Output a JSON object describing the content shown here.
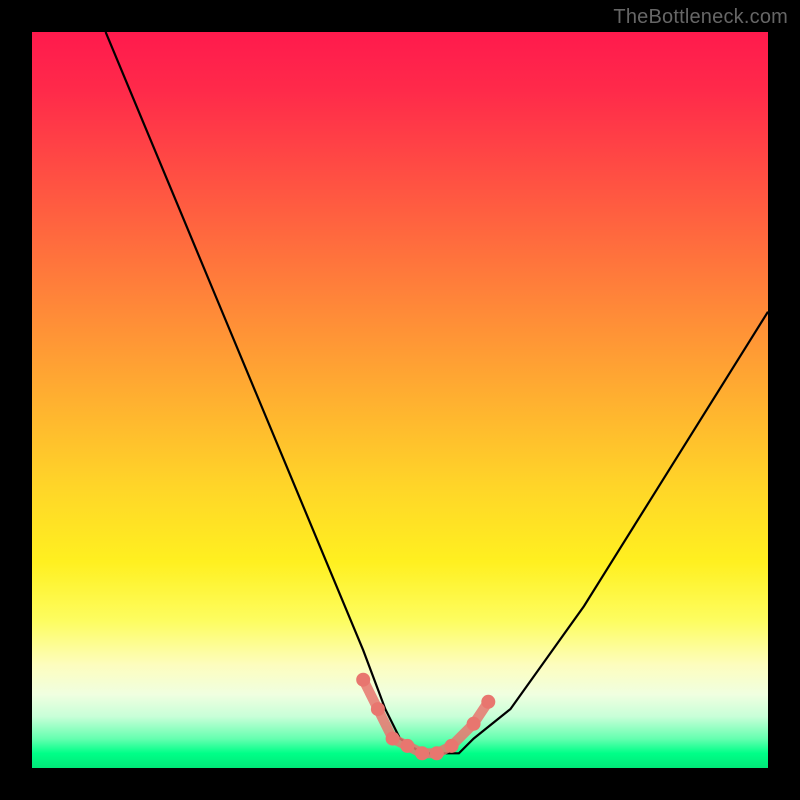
{
  "watermark": "TheBottleneck.com",
  "chart_data": {
    "type": "line",
    "title": "",
    "xlabel": "",
    "ylabel": "",
    "xlim": [
      0,
      100
    ],
    "ylim": [
      0,
      100
    ],
    "series": [
      {
        "name": "bottleneck-curve",
        "x": [
          10,
          15,
          20,
          25,
          30,
          35,
          40,
          45,
          48,
          50,
          53,
          55,
          58,
          60,
          65,
          70,
          75,
          80,
          85,
          90,
          95,
          100
        ],
        "values": [
          100,
          88,
          76,
          64,
          52,
          40,
          28,
          16,
          8,
          4,
          2,
          2,
          2,
          4,
          8,
          15,
          22,
          30,
          38,
          46,
          54,
          62
        ]
      }
    ],
    "markers": {
      "name": "highlight-points",
      "color": "#e8766f",
      "x": [
        45,
        47,
        49,
        51,
        53,
        55,
        57,
        60,
        62
      ],
      "values": [
        12,
        8,
        4,
        3,
        2,
        2,
        3,
        6,
        9
      ]
    }
  }
}
